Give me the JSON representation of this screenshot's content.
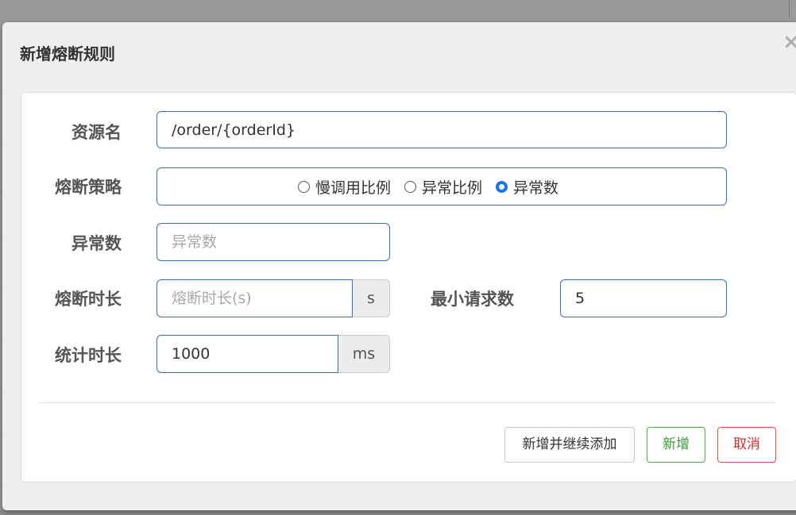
{
  "dialog": {
    "title": "新增熔断规则",
    "close_label": "×"
  },
  "form": {
    "resource": {
      "label": "资源名",
      "value": "/order/{orderId}"
    },
    "strategy": {
      "label": "熔断策略",
      "options": [
        "慢调用比例",
        "异常比例",
        "异常数"
      ],
      "selected": "异常数"
    },
    "exception_count": {
      "label": "异常数",
      "value": "",
      "placeholder": "异常数"
    },
    "break_duration": {
      "label": "熔断时长",
      "value": "",
      "placeholder": "熔断时长(s)",
      "unit": "s"
    },
    "min_requests": {
      "label": "最小请求数",
      "value": "5"
    },
    "stat_duration": {
      "label": "统计时长",
      "value": "1000",
      "unit": "ms"
    }
  },
  "footer": {
    "add_continue_label": "新增并继续添加",
    "add_label": "新增",
    "cancel_label": "取消"
  },
  "colors": {
    "input_border": "#3d6fa8",
    "radio_checked": "#1a73e8",
    "success": "#4cae4c",
    "danger": "#d9534f"
  }
}
